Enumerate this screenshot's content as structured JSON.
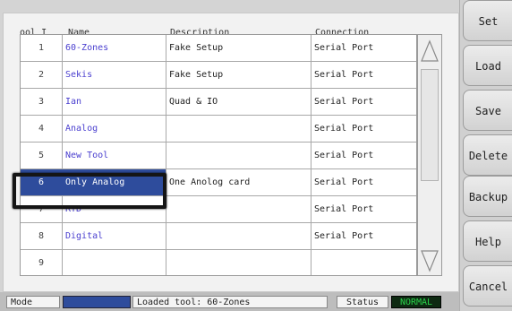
{
  "headers": {
    "tool": "ool I",
    "name": "Name",
    "description": "Description",
    "connection": "Connection"
  },
  "rows": [
    {
      "num": "1",
      "name": "60-Zones",
      "desc": "Fake Setup",
      "conn": "Serial Port"
    },
    {
      "num": "2",
      "name": "Sekis",
      "desc": "Fake Setup",
      "conn": "Serial Port"
    },
    {
      "num": "3",
      "name": "Ian",
      "desc": "Quad & IO",
      "conn": "Serial Port"
    },
    {
      "num": "4",
      "name": "Analog",
      "desc": "",
      "conn": "Serial Port"
    },
    {
      "num": "5",
      "name": "New Tool",
      "desc": "",
      "conn": "Serial Port"
    },
    {
      "num": "6",
      "name": "Only Analog",
      "desc": "One Anolog card",
      "conn": "Serial Port"
    },
    {
      "num": "7",
      "name": "RTD",
      "desc": "",
      "conn": "Serial Port"
    },
    {
      "num": "8",
      "name": "Digital",
      "desc": "",
      "conn": "Serial Port"
    },
    {
      "num": "9",
      "name": "",
      "desc": "",
      "conn": ""
    }
  ],
  "selected_row": "6",
  "status": {
    "mode_label": "Mode",
    "message": "Loaded tool: 60-Zones",
    "status_label": "Status",
    "status_value": "NORMAL"
  },
  "buttons": {
    "set": "Set",
    "load": "Load",
    "save": "Save",
    "delete": "Delete",
    "backup": "Backup",
    "help": "Help",
    "cancel": "Cancel"
  },
  "colors": {
    "selection": "#2e4c9c",
    "name_text": "#4a3fcf",
    "status_ok": "#2ad24a"
  }
}
